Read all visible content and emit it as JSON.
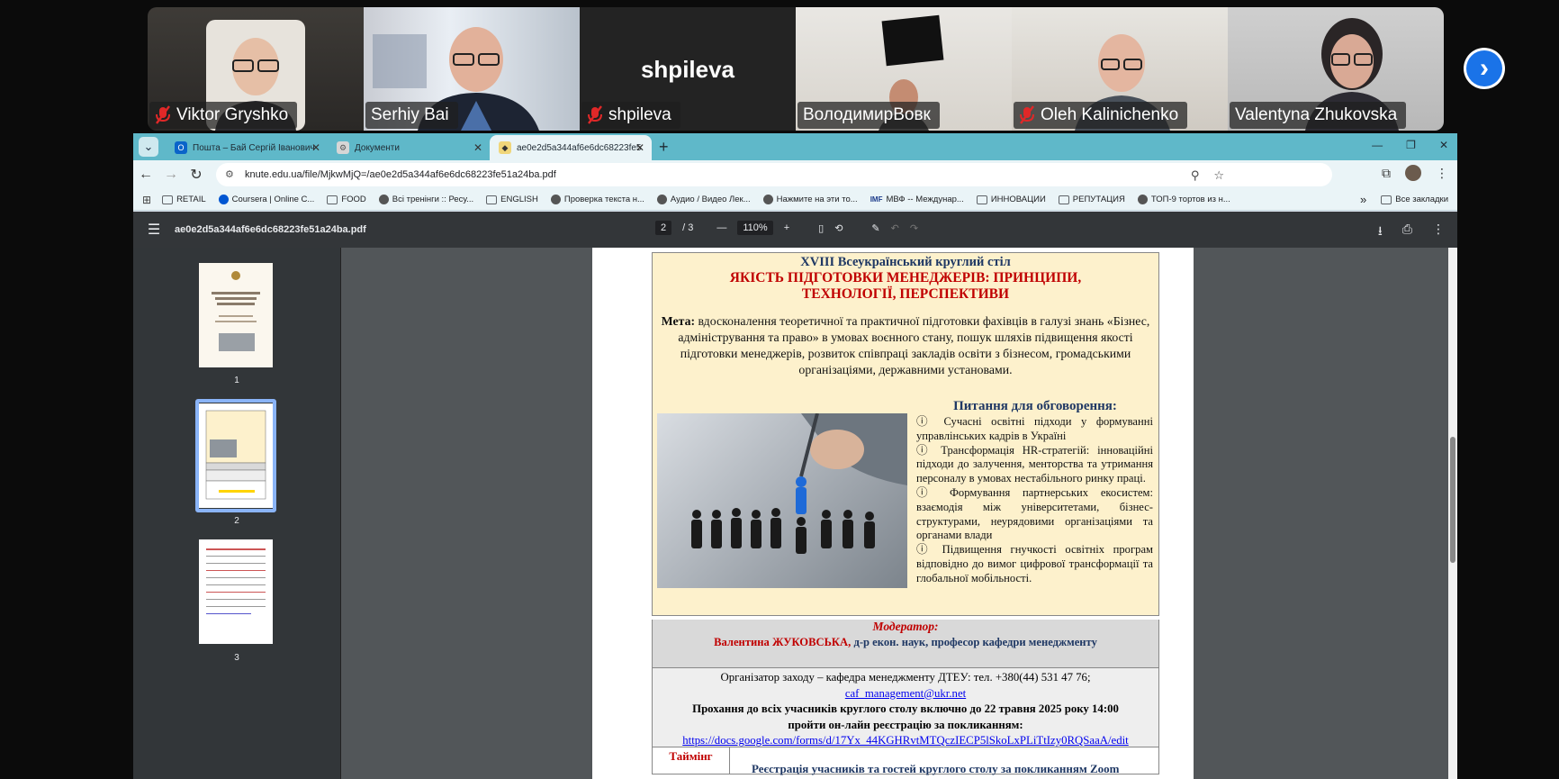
{
  "participants": [
    {
      "name": "Viktor Gryshko",
      "muted": true,
      "active": false
    },
    {
      "name": "Serhiy Bai",
      "muted": false,
      "active": true
    },
    {
      "name": "shpileva",
      "muted": true,
      "active": false,
      "big_label": "shpileva"
    },
    {
      "name": "ВолодимирВовк",
      "muted": false,
      "active": false
    },
    {
      "name": "Oleh Kalinichenko",
      "muted": true,
      "active": false
    },
    {
      "name": "Valentyna Zhukovska",
      "muted": false,
      "active": false
    }
  ],
  "browser": {
    "tabs": [
      {
        "label": "Пошта – Бай Сергій Іванович",
        "icon": "outlook-icon",
        "active": false
      },
      {
        "label": "Документи",
        "icon": "docs-icon",
        "active": false
      },
      {
        "label": "ae0e2d5a344af6e6dc68223fe5",
        "icon": "pdf-icon",
        "active": true
      }
    ],
    "url": "knute.edu.ua/file/MjkwMjQ=/ae0e2d5a344af6e6dc68223fe51a24ba.pdf",
    "bookmarks": [
      "RETAIL",
      "Coursera | Online C...",
      "FOOD",
      "Всі тренінги :: Ресу...",
      "ENGLISH",
      "Проверка текста н...",
      "Аудио / Видео Лек...",
      "Нажмите на эти то...",
      "МВФ -- Междунар...",
      "ИННОВАЦИИ",
      "РЕПУТАЦИЯ",
      "ТОП-9 тортов из н..."
    ],
    "all_bookmarks": "Все закладки"
  },
  "pdf": {
    "filename": "ae0e2d5a344af6e6dc68223fe51a24ba.pdf",
    "page": "2",
    "total": "/  3",
    "zoom": "110%",
    "thumbs": [
      "1",
      "2",
      "3"
    ]
  },
  "poster": {
    "title": "XVIII Всеукраїнський круглий стіл",
    "subtitle1": "ЯКІСТЬ ПІДГОТОВКИ МЕНЕДЖЕРІВ: ПРИНЦИПИ,",
    "subtitle2": "ТЕХНОЛОГІЇ, ПЕРСПЕКТИВИ",
    "goal_label": "Мета:",
    "goal_text": " вдосконалення теоретичної та практичної підготовки фахівців в галузі знань «Бізнес, адміністрування та право» в умовах воєнного стану, пошук шляхів підвищення якості підготовки менеджерів, розвиток співпраці закладів освіти з бізнесом, громадськими організаціями, державними установами.",
    "issues_title": "Питання для обговорення:",
    "issues": [
      " Сучасні освітні підходи у формуванні управлінських кадрів в Україні",
      " Трансформація HR-стратегій: інноваційні підходи до залучення, менторства та утримання персоналу в умовах нестабільного ринку праці.",
      " Формування партнерських екосистем: взаємодія між університетами, бізнес-структурами, неурядовими організаціями та органами влади",
      " Підвищення гнучкості освітніх програм відповідно до вимог цифрової трансформації та глобальної мобільності."
    ],
    "moderator_label": "Модератор:",
    "moderator_name": "Валентина ЖУКОВСЬКА,",
    "moderator_role": " д-р екон. наук,  професор кафедри менеджменту",
    "organizer": "Організатор заходу – кафедра менеджменту ДТЕУ: тел. +380(44) 531 47 76;",
    "email": "caf_management@ukr.net",
    "request1": "Прохання до всіх учасників круглого столу включно до 22 травня 2025 року 14:00",
    "request2": "пройти он-лайн реєстрацію за покликанням:",
    "reg_link": "https://docs.google.com/forms/d/17Yx_44KGHRvtMTQczIECP5lSkoLxPLiTtIzy0RQSaaA/edit",
    "timing_label": "Таймінг",
    "timing_row": "Реєстрація учасників та гостей круглого столу за покликанням Zoom"
  }
}
